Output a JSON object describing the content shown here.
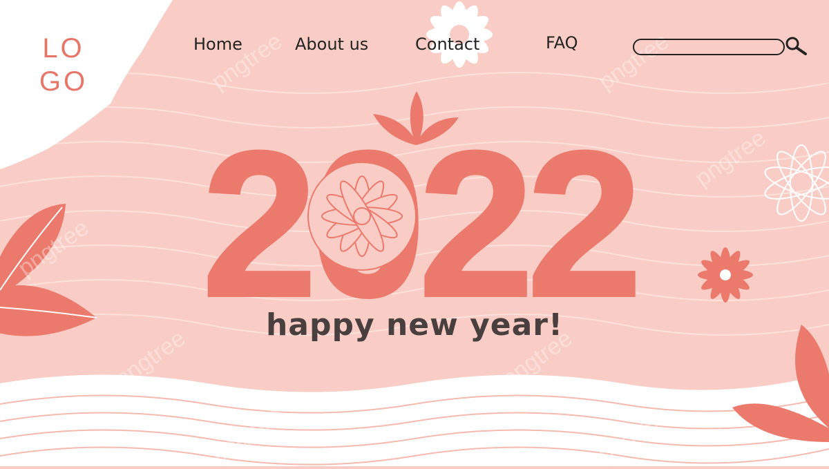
{
  "logo": {
    "line1": "LO",
    "line2": "GO"
  },
  "nav": {
    "items": [
      {
        "label": "Home"
      },
      {
        "label": "About us"
      },
      {
        "label": "Contact"
      },
      {
        "label": "FAQ"
      }
    ]
  },
  "search": {
    "placeholder": "",
    "value": ""
  },
  "hero": {
    "year": "2022",
    "tagline": "happy new year!"
  },
  "watermark": {
    "text": "pngtree"
  },
  "colors": {
    "background": "#f9cdc5",
    "accent": "#e87567",
    "white": "#ffffff",
    "text": "#222222"
  },
  "icons": [
    "search-icon",
    "daisy-flower-icon",
    "leaf-icon"
  ]
}
